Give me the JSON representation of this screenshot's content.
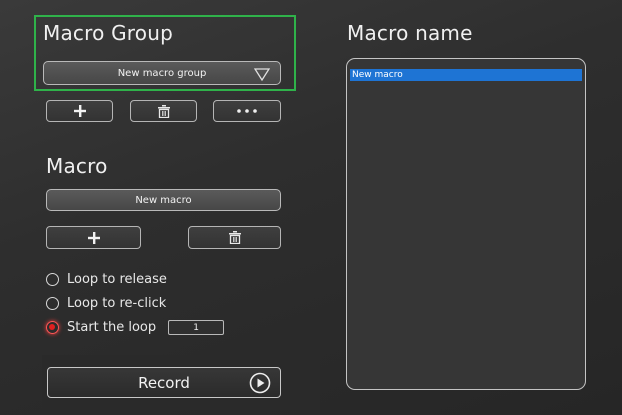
{
  "macro_group": {
    "title": "Macro Group",
    "selected_group": "New macro group"
  },
  "macro": {
    "title": "Macro",
    "current_macro": "New macro"
  },
  "loop_options": [
    {
      "label": "Loop to release",
      "checked": false
    },
    {
      "label": "Loop to re-click",
      "checked": false
    },
    {
      "label": "Start the loop",
      "checked": true
    }
  ],
  "loop_count": "1",
  "record": {
    "label": "Record"
  },
  "macro_name_panel": {
    "title": "Macro name",
    "items": [
      "New macro"
    ]
  },
  "colors": {
    "highlight_border": "#2fb24a",
    "selected_item": "#1e74d4",
    "radio_checked": "#e02020"
  }
}
